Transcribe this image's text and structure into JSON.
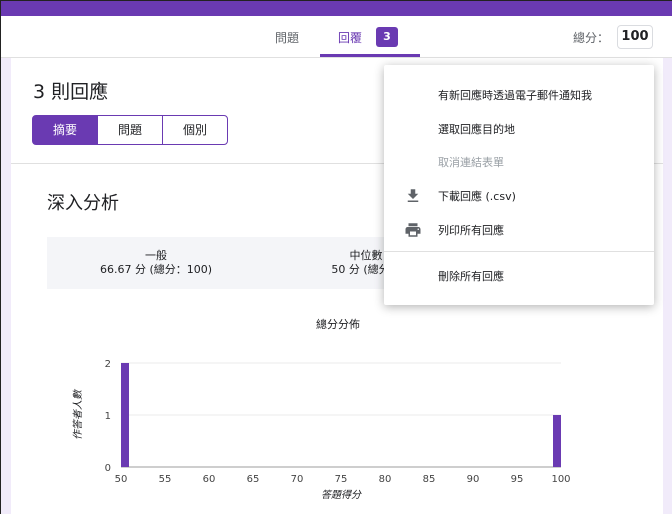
{
  "header": {
    "tabs": [
      {
        "label": "問題"
      },
      {
        "label": "回覆"
      }
    ],
    "responses_badge": "3",
    "total_label": "總分：",
    "total_value": "100"
  },
  "summary": {
    "title": "3 則回應",
    "segments": [
      "摘要",
      "問題",
      "個別"
    ]
  },
  "insights": {
    "title": "深入分析",
    "stats": [
      {
        "label": "一般",
        "value": "66.67 分 (總分：100)"
      },
      {
        "label": "中位數",
        "value": "50 分 (總分："
      }
    ]
  },
  "chart_data": {
    "type": "bar",
    "title": "總分分佈",
    "xlabel": "答題得分",
    "ylabel": "作答者人數",
    "x_ticks": [
      50,
      55,
      60,
      65,
      70,
      75,
      80,
      85,
      90,
      95,
      100
    ],
    "y_ticks": [
      0,
      1,
      2
    ],
    "xlim": [
      50,
      100
    ],
    "ylim": [
      0,
      2
    ],
    "grid": true,
    "series": [
      {
        "x": [
          50,
          100
        ],
        "values": [
          2,
          1
        ]
      }
    ],
    "bar_color": "#6a3ab2"
  },
  "menu": {
    "items": [
      {
        "label": "有新回應時透過電子郵件通知我",
        "icon": "",
        "disabled": false
      },
      {
        "label": "選取回應目的地",
        "icon": "",
        "disabled": false
      },
      {
        "label": "取消連結表單",
        "icon": "",
        "disabled": true
      },
      {
        "label": "下載回應 (.csv)",
        "icon": "download-icon",
        "disabled": false
      },
      {
        "label": "列印所有回應",
        "icon": "print-icon",
        "disabled": false
      },
      {
        "label": "刪除所有回應",
        "icon": "",
        "disabled": false
      }
    ]
  },
  "colors": {
    "accent": "#6a3ab2",
    "background": "#f1ebfa"
  }
}
